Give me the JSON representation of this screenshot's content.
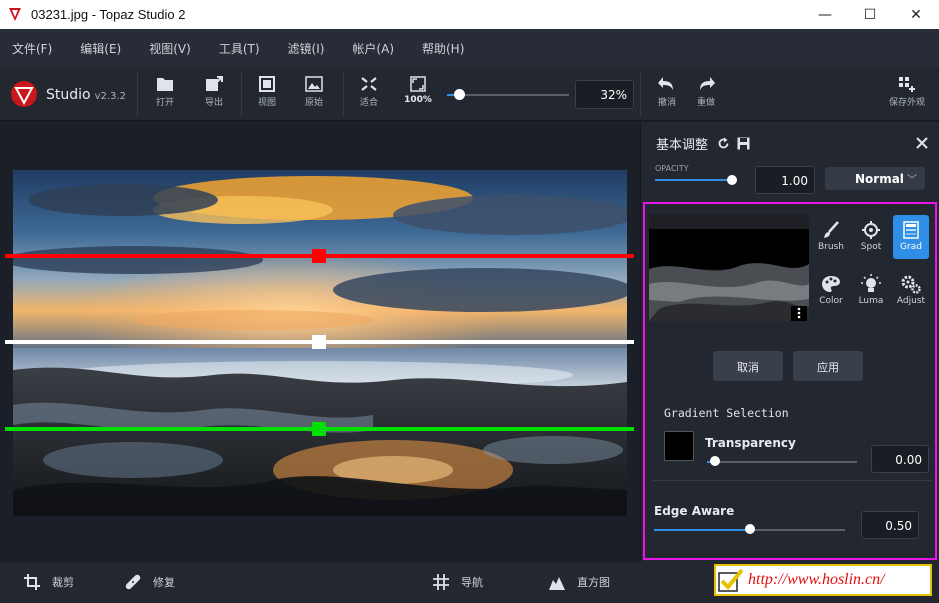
{
  "window": {
    "title": "03231.jpg - Topaz Studio 2",
    "minimize": "—",
    "maximize": "☐",
    "close": "✕"
  },
  "menu": [
    "文件(F)",
    "编辑(E)",
    "视图(V)",
    "工具(T)",
    "滤镜(I)",
    "帐户(A)",
    "帮助(H)"
  ],
  "brand": {
    "name": "Studio",
    "version": "v2.3.2"
  },
  "toolbar": {
    "open": "打开",
    "export": "导出",
    "view": "视图",
    "original": "原始",
    "fit": "适合",
    "hundred": "100%",
    "zoom_value": "32%",
    "zoom_fraction": 0.1,
    "undo": "撤消",
    "redo": "重做",
    "save_look": "保存外观"
  },
  "panel": {
    "title": "基本调整",
    "opacity_label": "OPACITY",
    "opacity_value": "1.00",
    "opacity_fraction": 1.0,
    "blend_mode": "Normal",
    "tools": [
      {
        "label": "Brush",
        "icon": "brush-icon"
      },
      {
        "label": "Spot",
        "icon": "spot-icon"
      },
      {
        "label": "Grad",
        "icon": "gradient-icon",
        "active": true
      },
      {
        "label": "Color",
        "icon": "palette-icon"
      },
      {
        "label": "Luma",
        "icon": "luma-icon"
      },
      {
        "label": "Adjust",
        "icon": "adjust-icon"
      }
    ],
    "cancel": "取消",
    "apply": "应用",
    "gradient_selection": "Gradient Selection",
    "transparency_label": "Transparency",
    "transparency_value": "0.00",
    "transparency_fraction": 0.0,
    "edge_aware_label": "Edge Aware",
    "edge_aware_value": "0.50",
    "edge_aware_fraction": 0.5
  },
  "bottom": {
    "crop": "裁剪",
    "repair": "修复",
    "navigate": "导航",
    "histogram": "直方图"
  },
  "colors": {
    "accent": "#2f8ee5",
    "line_top": "#ff0000",
    "line_mid": "#ffffff",
    "line_bottom": "#00e000",
    "highlight": "#e815e8"
  },
  "watermark": {
    "text": "http://www.hoslin.cn/"
  }
}
